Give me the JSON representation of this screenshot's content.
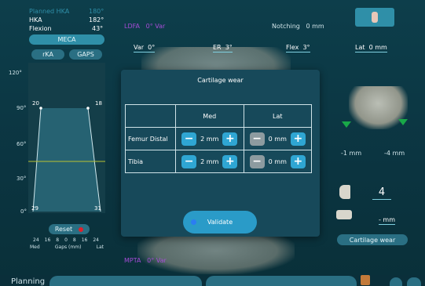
{
  "stats": {
    "planned_hka_label": "Planned HKA",
    "planned_hka_value": "180°",
    "hka_label": "HKA",
    "hka_value": "182°",
    "flexion_label": "Flexion",
    "flexion_value": "43°"
  },
  "mode_buttons": {
    "meca": "MECA",
    "rka": "rKA",
    "gaps": "GAPS"
  },
  "gap_chart": {
    "y_ticks": [
      "120°",
      "90°",
      "60°",
      "30°",
      "0°"
    ],
    "top_left_value": "20",
    "top_right_value": "18",
    "bottom_left_value": "29",
    "bottom_right_value": "31",
    "reset_label": "Reset",
    "x_ticks": [
      "24",
      "16",
      "8",
      "0",
      "8",
      "16",
      "24"
    ],
    "axis_left": "Med",
    "axis_center": "Gaps (mm)",
    "axis_right": "Lat",
    "colors": {
      "trace": "#4db7cc",
      "threshold": "#b9c233",
      "reset_dot": "#e2202a"
    }
  },
  "top_bar": {
    "ldfa_label": "LDFA",
    "ldfa_value": "0° Var",
    "notching_label": "Notching",
    "notching_value": "0 mm",
    "var_label": "Var",
    "var_value": "0°",
    "er_label": "ER",
    "er_value": "3°",
    "flex_label": "Flex",
    "flex_value": "3°",
    "lat_label": "Lat",
    "lat_value": "0 mm"
  },
  "right_panel": {
    "minus_left": "-1 mm",
    "minus_right": "-4 mm",
    "insert_size": "4",
    "insert_mm": "- mm",
    "cartilage_button": "Cartilage wear"
  },
  "bottom": {
    "mpta_label": "MPTA",
    "mpta_value": "0° Var",
    "planning_label": "Planning"
  },
  "dialog": {
    "title": "Cartilage wear",
    "col_med": "Med",
    "col_lat": "Lat",
    "rows": [
      {
        "label": "Femur Distal",
        "med": "2 mm",
        "lat": "0 mm"
      },
      {
        "label": "Tibia",
        "med": "2 mm",
        "lat": "0 mm"
      }
    ],
    "minus_glyph": "−",
    "plus_glyph": "+",
    "validate_label": "Validate",
    "colors": {
      "accent": "#2fa6d3",
      "disabled": "#8d9ba0",
      "panel": "#17495a"
    }
  }
}
